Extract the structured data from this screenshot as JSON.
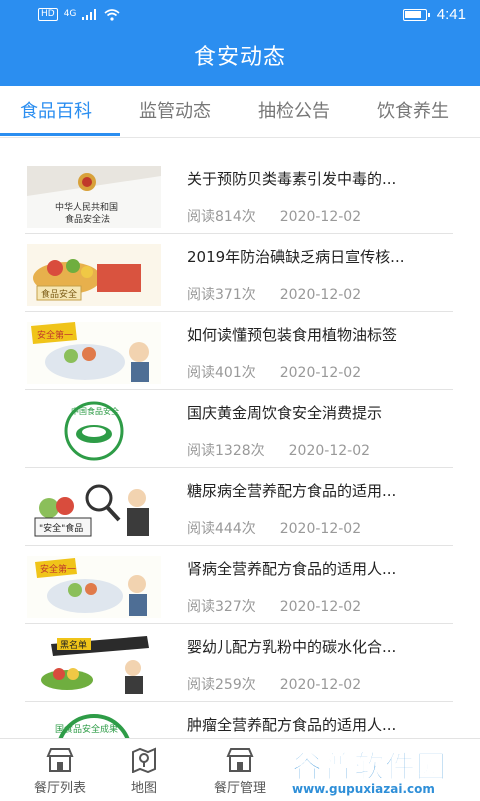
{
  "status_bar": {
    "network": "HD",
    "signal_type": "4G",
    "time": "4:41",
    "battery_level": 0.85
  },
  "header": {
    "title": "食安动态"
  },
  "tabs": [
    {
      "label": "食品百科",
      "active": true
    },
    {
      "label": "监管动态",
      "active": false
    },
    {
      "label": "抽检公告",
      "active": false
    },
    {
      "label": "饮食养生",
      "active": false
    }
  ],
  "articles": [
    {
      "title": "关于预防贝类毒素引发中毒的...",
      "reads": "阅读814次",
      "date": "2020-12-02",
      "thumb_text": "中华人民共和国 食品安全法"
    },
    {
      "title": "2019年防治碘缺乏病日宣传核...",
      "reads": "阅读371次",
      "date": "2020-12-02",
      "thumb_text": "食品安全"
    },
    {
      "title": "如何读懂预包装食用植物油标签",
      "reads": "阅读401次",
      "date": "2020-12-02",
      "thumb_text": "安全第一"
    },
    {
      "title": "国庆黄金周饮食安全消费提示",
      "reads": "阅读1328次",
      "date": "2020-12-02",
      "thumb_text": "中国食品安全"
    },
    {
      "title": "糖尿病全营养配方食品的适用...",
      "reads": "阅读444次",
      "date": "2020-12-02",
      "thumb_text": "\"安全\"食品"
    },
    {
      "title": "肾病全营养配方食品的适用人...",
      "reads": "阅读327次",
      "date": "2020-12-02",
      "thumb_text": "安全第一"
    },
    {
      "title": "婴幼儿配方乳粉中的碳水化合...",
      "reads": "阅读259次",
      "date": "2020-12-02",
      "thumb_text": "黑名单"
    },
    {
      "title": "肿瘤全营养配方食品的适用人...",
      "reads": "",
      "date": "",
      "thumb_text": "国食品安全成果"
    }
  ],
  "bottom_nav": [
    {
      "label": "餐厅列表",
      "icon": "restaurant-icon"
    },
    {
      "label": "地图",
      "icon": "map-icon"
    },
    {
      "label": "餐厅管理",
      "icon": "restaurant-manage-icon"
    }
  ],
  "watermark": {
    "main": "谷普软件园",
    "url": "www.gupuxiazai.com"
  },
  "colors": {
    "primary": "#2b8ef0",
    "text": "#222222",
    "meta": "#999999",
    "tab_inactive": "#777777"
  }
}
